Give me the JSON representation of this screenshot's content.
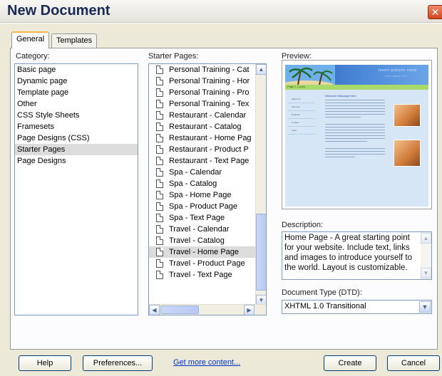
{
  "window": {
    "title": "New Document",
    "close_glyph": "✕"
  },
  "tabs": [
    {
      "label": "General"
    },
    {
      "label": "Templates"
    }
  ],
  "labels": {
    "category": "Category:",
    "starter_pages": "Starter Pages:",
    "preview": "Preview:",
    "description": "Description:",
    "doctype": "Document Type (DTD):"
  },
  "categories": [
    {
      "label": "Basic page"
    },
    {
      "label": "Dynamic page"
    },
    {
      "label": "Template page"
    },
    {
      "label": "Other"
    },
    {
      "label": "CSS Style Sheets"
    },
    {
      "label": "Framesets"
    },
    {
      "label": "Page Designs (CSS)"
    },
    {
      "label": "Starter Pages",
      "selected": true
    },
    {
      "label": "Page Designs"
    }
  ],
  "starter_pages": [
    {
      "label": "Personal Training - Cat"
    },
    {
      "label": "Personal Training - Hor"
    },
    {
      "label": "Personal Training - Pro"
    },
    {
      "label": "Personal Training - Tex"
    },
    {
      "label": "Restaurant - Calendar"
    },
    {
      "label": "Restaurant - Catalog"
    },
    {
      "label": "Restaurant - Home Pag"
    },
    {
      "label": "Restaurant - Product P"
    },
    {
      "label": "Restaurant - Text Page"
    },
    {
      "label": "Spa - Calendar"
    },
    {
      "label": "Spa - Catalog"
    },
    {
      "label": "Spa - Home Page"
    },
    {
      "label": "Spa - Product Page"
    },
    {
      "label": "Spa - Text Page"
    },
    {
      "label": "Travel - Calendar"
    },
    {
      "label": "Travel - Catalog"
    },
    {
      "label": "Travel - Home Page",
      "selected": true
    },
    {
      "label": "Travel - Product Page"
    },
    {
      "label": "Travel - Text Page"
    }
  ],
  "preview": {
    "header_title": "insert website name",
    "header_subtitle": "enter tagline here",
    "nav_text": "Page 1 | Links",
    "heading": "Welcome Message Here",
    "side_links": [
      "About Us",
      "Services",
      "Products",
      "Contact",
      "Links"
    ]
  },
  "description": "Home Page - A great starting point for your website. Include text, links and images to introduce yourself to the world. Layout is customizable.",
  "doctype": {
    "value": "XHTML 1.0 Transitional"
  },
  "buttons": {
    "help": "Help",
    "preferences": "Preferences...",
    "more_content": "Get more content...",
    "create": "Create",
    "cancel": "Cancel"
  },
  "colors": {
    "title_text": "#1a2a55",
    "dialog_bg": "#ece9d8",
    "close_red": "#d0451f",
    "tab_highlight": "#f7b64a"
  }
}
